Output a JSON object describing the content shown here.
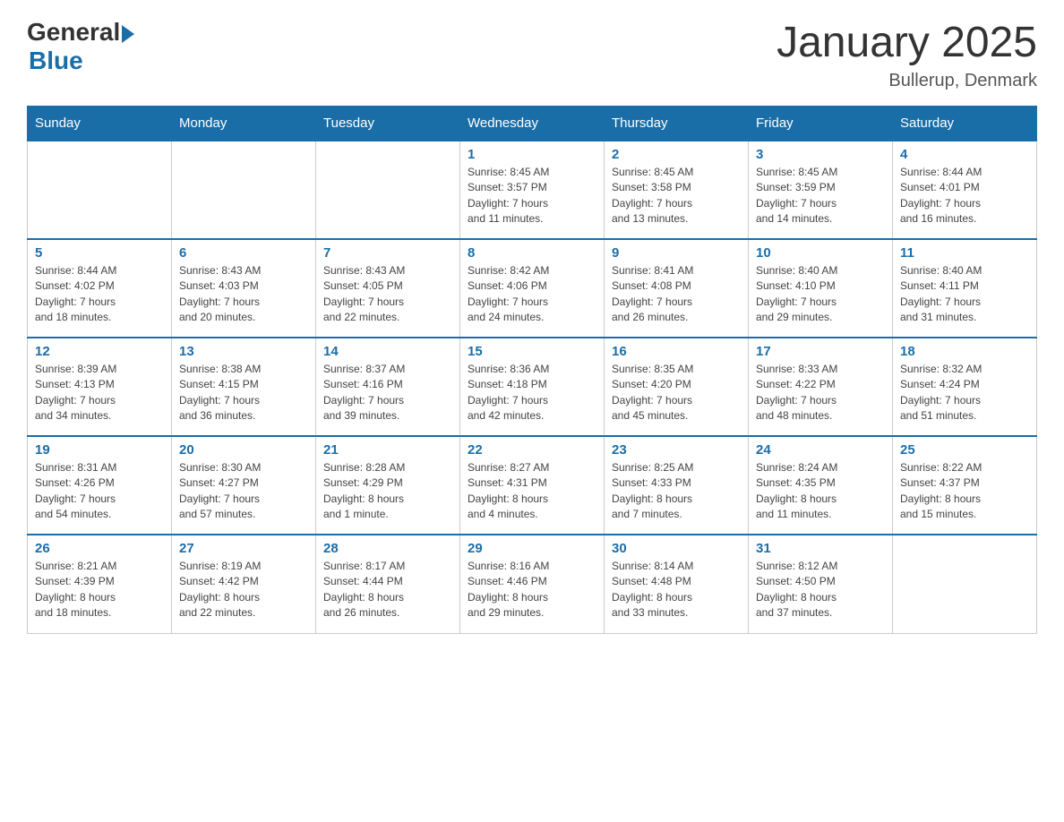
{
  "header": {
    "logo_general": "General",
    "logo_blue": "Blue",
    "title": "January 2025",
    "subtitle": "Bullerup, Denmark"
  },
  "weekdays": [
    "Sunday",
    "Monday",
    "Tuesday",
    "Wednesday",
    "Thursday",
    "Friday",
    "Saturday"
  ],
  "weeks": [
    [
      {
        "day": "",
        "info": ""
      },
      {
        "day": "",
        "info": ""
      },
      {
        "day": "",
        "info": ""
      },
      {
        "day": "1",
        "info": "Sunrise: 8:45 AM\nSunset: 3:57 PM\nDaylight: 7 hours\nand 11 minutes."
      },
      {
        "day": "2",
        "info": "Sunrise: 8:45 AM\nSunset: 3:58 PM\nDaylight: 7 hours\nand 13 minutes."
      },
      {
        "day": "3",
        "info": "Sunrise: 8:45 AM\nSunset: 3:59 PM\nDaylight: 7 hours\nand 14 minutes."
      },
      {
        "day": "4",
        "info": "Sunrise: 8:44 AM\nSunset: 4:01 PM\nDaylight: 7 hours\nand 16 minutes."
      }
    ],
    [
      {
        "day": "5",
        "info": "Sunrise: 8:44 AM\nSunset: 4:02 PM\nDaylight: 7 hours\nand 18 minutes."
      },
      {
        "day": "6",
        "info": "Sunrise: 8:43 AM\nSunset: 4:03 PM\nDaylight: 7 hours\nand 20 minutes."
      },
      {
        "day": "7",
        "info": "Sunrise: 8:43 AM\nSunset: 4:05 PM\nDaylight: 7 hours\nand 22 minutes."
      },
      {
        "day": "8",
        "info": "Sunrise: 8:42 AM\nSunset: 4:06 PM\nDaylight: 7 hours\nand 24 minutes."
      },
      {
        "day": "9",
        "info": "Sunrise: 8:41 AM\nSunset: 4:08 PM\nDaylight: 7 hours\nand 26 minutes."
      },
      {
        "day": "10",
        "info": "Sunrise: 8:40 AM\nSunset: 4:10 PM\nDaylight: 7 hours\nand 29 minutes."
      },
      {
        "day": "11",
        "info": "Sunrise: 8:40 AM\nSunset: 4:11 PM\nDaylight: 7 hours\nand 31 minutes."
      }
    ],
    [
      {
        "day": "12",
        "info": "Sunrise: 8:39 AM\nSunset: 4:13 PM\nDaylight: 7 hours\nand 34 minutes."
      },
      {
        "day": "13",
        "info": "Sunrise: 8:38 AM\nSunset: 4:15 PM\nDaylight: 7 hours\nand 36 minutes."
      },
      {
        "day": "14",
        "info": "Sunrise: 8:37 AM\nSunset: 4:16 PM\nDaylight: 7 hours\nand 39 minutes."
      },
      {
        "day": "15",
        "info": "Sunrise: 8:36 AM\nSunset: 4:18 PM\nDaylight: 7 hours\nand 42 minutes."
      },
      {
        "day": "16",
        "info": "Sunrise: 8:35 AM\nSunset: 4:20 PM\nDaylight: 7 hours\nand 45 minutes."
      },
      {
        "day": "17",
        "info": "Sunrise: 8:33 AM\nSunset: 4:22 PM\nDaylight: 7 hours\nand 48 minutes."
      },
      {
        "day": "18",
        "info": "Sunrise: 8:32 AM\nSunset: 4:24 PM\nDaylight: 7 hours\nand 51 minutes."
      }
    ],
    [
      {
        "day": "19",
        "info": "Sunrise: 8:31 AM\nSunset: 4:26 PM\nDaylight: 7 hours\nand 54 minutes."
      },
      {
        "day": "20",
        "info": "Sunrise: 8:30 AM\nSunset: 4:27 PM\nDaylight: 7 hours\nand 57 minutes."
      },
      {
        "day": "21",
        "info": "Sunrise: 8:28 AM\nSunset: 4:29 PM\nDaylight: 8 hours\nand 1 minute."
      },
      {
        "day": "22",
        "info": "Sunrise: 8:27 AM\nSunset: 4:31 PM\nDaylight: 8 hours\nand 4 minutes."
      },
      {
        "day": "23",
        "info": "Sunrise: 8:25 AM\nSunset: 4:33 PM\nDaylight: 8 hours\nand 7 minutes."
      },
      {
        "day": "24",
        "info": "Sunrise: 8:24 AM\nSunset: 4:35 PM\nDaylight: 8 hours\nand 11 minutes."
      },
      {
        "day": "25",
        "info": "Sunrise: 8:22 AM\nSunset: 4:37 PM\nDaylight: 8 hours\nand 15 minutes."
      }
    ],
    [
      {
        "day": "26",
        "info": "Sunrise: 8:21 AM\nSunset: 4:39 PM\nDaylight: 8 hours\nand 18 minutes."
      },
      {
        "day": "27",
        "info": "Sunrise: 8:19 AM\nSunset: 4:42 PM\nDaylight: 8 hours\nand 22 minutes."
      },
      {
        "day": "28",
        "info": "Sunrise: 8:17 AM\nSunset: 4:44 PM\nDaylight: 8 hours\nand 26 minutes."
      },
      {
        "day": "29",
        "info": "Sunrise: 8:16 AM\nSunset: 4:46 PM\nDaylight: 8 hours\nand 29 minutes."
      },
      {
        "day": "30",
        "info": "Sunrise: 8:14 AM\nSunset: 4:48 PM\nDaylight: 8 hours\nand 33 minutes."
      },
      {
        "day": "31",
        "info": "Sunrise: 8:12 AM\nSunset: 4:50 PM\nDaylight: 8 hours\nand 37 minutes."
      },
      {
        "day": "",
        "info": ""
      }
    ]
  ]
}
